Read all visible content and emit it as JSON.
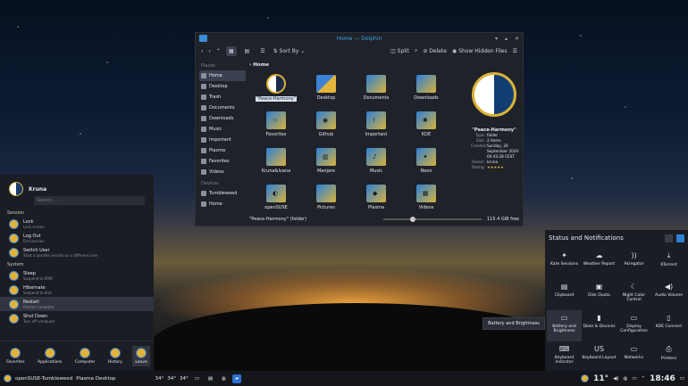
{
  "dolphin": {
    "title": "Home — Dolphin",
    "toolbar": {
      "sort": "Sort By",
      "split": "Split",
      "delete": "Delete",
      "hidden": "Show Hidden Files"
    },
    "places_header": "Places",
    "places": [
      "Home",
      "Desktop",
      "Trash",
      "Documents",
      "Downloads",
      "Music",
      "Important",
      "Plasma",
      "Favorites",
      "Videos"
    ],
    "devices_header": "Devices",
    "devices": [
      "Tumbleweed",
      "Home"
    ],
    "breadcrumb": "Home",
    "items": [
      "\"Peace-Harmony\"",
      "Desktop",
      "Documents",
      "Downloads",
      "Favorites",
      "Github",
      "Important",
      "KDE",
      "Kruna&Ivana",
      "Manjaro",
      "Music",
      "Neon",
      "openSUSE",
      "Pictures",
      "Plasma",
      "Videos"
    ],
    "info": {
      "title": "\"Peace-Harmony\"",
      "rows": [
        [
          "Type:",
          "folder"
        ],
        [
          "Size:",
          "2 items"
        ],
        [
          "Created:",
          "Sunday, 20 September 2020 00:43:28 CEST"
        ],
        [
          "Owner:",
          "kruna"
        ],
        [
          "Rating:",
          "★★★★★"
        ]
      ]
    },
    "status": "\"Peace-Harmony\" (folder)",
    "free": "115.4 GiB free"
  },
  "kickoff": {
    "user": "Kruna",
    "search_placeholder": "Search...",
    "session_header": "Session",
    "session": [
      [
        "Lock",
        "Lock screen"
      ],
      [
        "Log Out",
        "End session"
      ],
      [
        "Switch User",
        "Start a parallel session as a different user"
      ]
    ],
    "system_header": "System",
    "system": [
      [
        "Sleep",
        "Suspend to RAM"
      ],
      [
        "Hibernate",
        "Suspend to disk"
      ],
      [
        "Restart",
        "Restart computer"
      ],
      [
        "Shut Down",
        "Turn off computer"
      ]
    ],
    "tabs": [
      "Favorites",
      "Applications",
      "Computer",
      "History",
      "Leave"
    ]
  },
  "notifications": {
    "title": "Status and Notifications",
    "items": [
      {
        "label": "Kate Sessions",
        "icon": "✦"
      },
      {
        "label": "Weather Report",
        "icon": "☁"
      },
      {
        "label": "Akregator",
        "icon": "))"
      },
      {
        "label": "KTorrent",
        "icon": "⤓"
      },
      {
        "label": "Clipboard",
        "icon": "▤"
      },
      {
        "label": "Disk Quota",
        "icon": "▣"
      },
      {
        "label": "Night Color Control",
        "icon": "☾"
      },
      {
        "label": "Audio Volume",
        "icon": "◀)"
      },
      {
        "label": "Battery and Brightness",
        "icon": "▭"
      },
      {
        "label": "Disks & Devices",
        "icon": "▮"
      },
      {
        "label": "Display Configuration",
        "icon": "▭"
      },
      {
        "label": "KDE Connect",
        "icon": "▯"
      },
      {
        "label": "Keyboard Indicator",
        "icon": "⌨"
      },
      {
        "label": "Keyboard Layout",
        "icon": "US"
      },
      {
        "label": "Networks",
        "icon": "▭"
      },
      {
        "label": "Printers",
        "icon": "⎙"
      }
    ]
  },
  "tooltip": "Battery and Brightness",
  "taskbar": {
    "distro": "openSUSE-Tumbleweed",
    "desktop": "Plasma Desktop",
    "temp1": "34°",
    "temp2": "34°",
    "temp3": "34°",
    "weather_temp": "11°",
    "clock": "18:46"
  }
}
